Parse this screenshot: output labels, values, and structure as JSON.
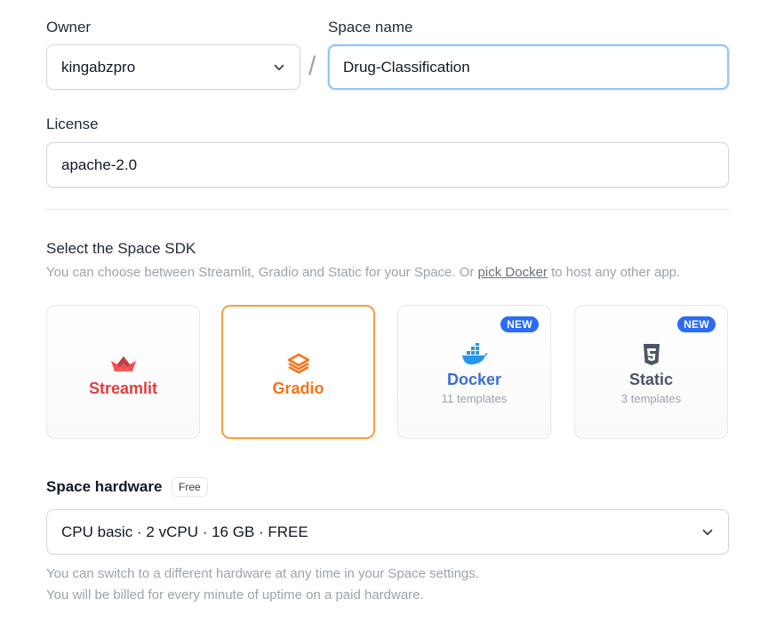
{
  "owner": {
    "label": "Owner",
    "value": "kingabzpro"
  },
  "separator": "/",
  "space_name": {
    "label": "Space name",
    "value": "Drug-Classification"
  },
  "license": {
    "label": "License",
    "value": "apache-2.0"
  },
  "sdk": {
    "title": "Select the Space SDK",
    "desc_before": "You can choose between Streamlit, Gradio and Static for your Space. Or ",
    "desc_link": "pick Docker",
    "desc_after": " to host any other app.",
    "cards": [
      {
        "name": "Streamlit",
        "color": "#e53e3e",
        "icon": "streamlit-crown-icon",
        "selected": false
      },
      {
        "name": "Gradio",
        "color": "#f97316",
        "icon": "gradio-logo-icon",
        "selected": true
      },
      {
        "name": "Docker",
        "templates": "11 templates",
        "badge": "NEW",
        "color": "#3b6fd8",
        "icon": "docker-whale-icon",
        "selected": false
      },
      {
        "name": "Static",
        "templates": "3 templates",
        "badge": "NEW",
        "color": "#4b5563",
        "icon": "html5-shield-icon",
        "selected": false
      }
    ]
  },
  "hardware": {
    "title": "Space hardware",
    "tag": "Free",
    "value": "CPU basic · 2 vCPU · 16 GB · FREE",
    "note_1": "You can switch to a different hardware at any time in your Space settings.",
    "note_2": "You will be billed for every minute of uptime on a paid hardware."
  },
  "colors": {
    "focus_border": "#93c5fd",
    "selected_border": "#f59e42",
    "badge_bg": "#2b6cf6"
  }
}
